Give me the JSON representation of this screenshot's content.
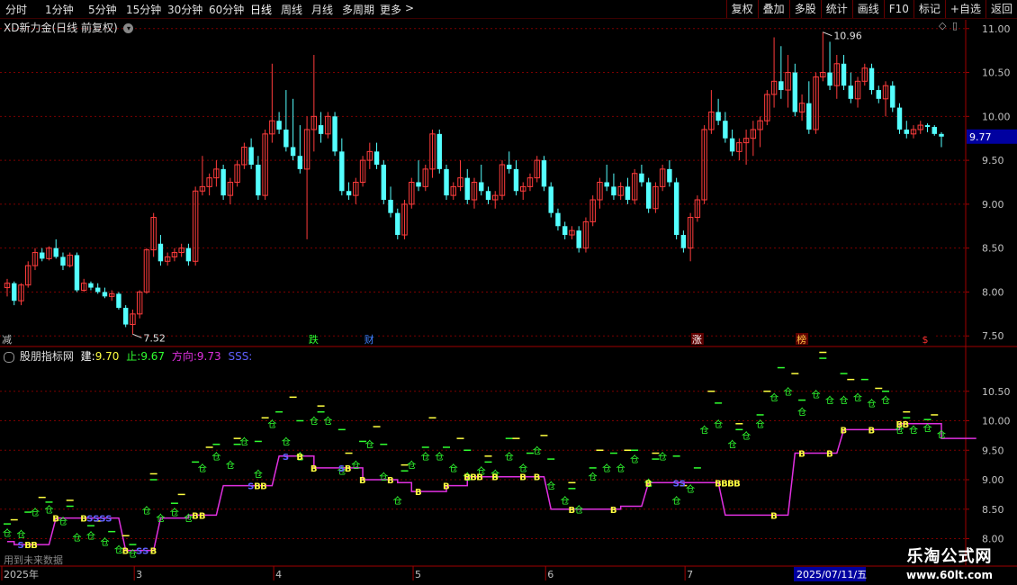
{
  "toolbar": {
    "periods": [
      "分时",
      "1分钟",
      "5分钟",
      "15分钟",
      "30分钟",
      "60分钟",
      "日线",
      "周线",
      "月线",
      "多周期",
      "更多"
    ],
    "active_period": "日线",
    "more_arrow": ">",
    "right_buttons": [
      "复权",
      "叠加",
      "多股",
      "统计",
      "画线",
      "F10",
      "标记",
      "+自选",
      "返回"
    ]
  },
  "main_panel": {
    "title": "XD新力金(日线 前复权)",
    "dropdown_icon": "circle-down-icon",
    "y_ticks": [
      "11.00",
      "10.50",
      "10.00",
      "9.50",
      "9.00",
      "8.50",
      "8.00",
      "7.50"
    ],
    "current_price": "9.77",
    "high_label": "10.96",
    "low_label": "7.52",
    "event_markers": [
      "减",
      "跌",
      "财",
      "涨",
      "榜",
      "$"
    ]
  },
  "indicator_panel": {
    "name": "股朋指标网",
    "jian_label": "建:",
    "jian_value": "9.70",
    "zhi_label": "止:",
    "zhi_value": "9.67",
    "fx_label": "方向:",
    "fx_value": "9.73",
    "sss": "SSS:",
    "y_ticks": [
      "10.50",
      "10.00",
      "9.50",
      "9.00",
      "8.50",
      "8.00"
    ],
    "future_note": "用到未来数据"
  },
  "xaxis": {
    "labels": [
      "2025年",
      "3",
      "4",
      "5",
      "6",
      "7"
    ],
    "date_box": "2025/07/11/五"
  },
  "watermark": {
    "title": "乐淘公式网",
    "url": "www.60lt.com"
  },
  "colors": {
    "up": "#ff3c3c",
    "down": "#54ffff",
    "grid": "#7a0000",
    "line": "#e030e0",
    "buy": "#ffff40",
    "sell": "#6060ff",
    "green": "#30ff30"
  },
  "chart_data": {
    "type": "candlestick",
    "ylim": [
      7.4,
      11.1
    ],
    "candles": [
      [
        8.05,
        8.15,
        7.95,
        8.1
      ],
      [
        8.1,
        8.12,
        7.85,
        7.9
      ],
      [
        7.9,
        8.1,
        7.85,
        8.08
      ],
      [
        8.08,
        8.35,
        8.05,
        8.3
      ],
      [
        8.3,
        8.5,
        8.25,
        8.45
      ],
      [
        8.45,
        8.5,
        8.35,
        8.38
      ],
      [
        8.38,
        8.52,
        8.36,
        8.5
      ],
      [
        8.5,
        8.6,
        8.38,
        8.4
      ],
      [
        8.4,
        8.45,
        8.25,
        8.3
      ],
      [
        8.3,
        8.45,
        8.28,
        8.42
      ],
      [
        8.42,
        8.45,
        8.0,
        8.02
      ],
      [
        8.02,
        8.15,
        8.0,
        8.1
      ],
      [
        8.1,
        8.12,
        8.02,
        8.05
      ],
      [
        8.05,
        8.1,
        7.98,
        8.0
      ],
      [
        8.0,
        8.05,
        7.93,
        7.95
      ],
      [
        7.95,
        8.02,
        7.9,
        7.98
      ],
      [
        7.98,
        8.0,
        7.8,
        7.82
      ],
      [
        7.82,
        7.85,
        7.6,
        7.63
      ],
      [
        7.63,
        7.8,
        7.52,
        7.75
      ],
      [
        7.75,
        8.02,
        7.7,
        8.0
      ],
      [
        8.0,
        8.5,
        7.98,
        8.48
      ],
      [
        8.48,
        8.9,
        8.4,
        8.85
      ],
      [
        8.55,
        8.65,
        8.3,
        8.35
      ],
      [
        8.35,
        8.45,
        8.3,
        8.4
      ],
      [
        8.4,
        8.5,
        8.35,
        8.45
      ],
      [
        8.45,
        8.55,
        8.4,
        8.5
      ],
      [
        8.5,
        8.55,
        8.3,
        8.35
      ],
      [
        8.35,
        9.2,
        8.3,
        9.15
      ],
      [
        9.15,
        9.55,
        9.1,
        9.2
      ],
      [
        9.2,
        9.35,
        9.1,
        9.3
      ],
      [
        9.3,
        9.5,
        9.2,
        9.4
      ],
      [
        9.4,
        9.45,
        9.05,
        9.1
      ],
      [
        9.1,
        9.3,
        9.0,
        9.25
      ],
      [
        9.25,
        9.5,
        9.2,
        9.45
      ],
      [
        9.45,
        9.7,
        9.4,
        9.65
      ],
      [
        9.65,
        9.75,
        9.4,
        9.45
      ],
      [
        9.45,
        9.55,
        9.05,
        9.1
      ],
      [
        9.1,
        9.85,
        9.05,
        9.8
      ],
      [
        9.8,
        10.6,
        9.7,
        9.95
      ],
      [
        9.95,
        10.05,
        9.8,
        9.85
      ],
      [
        9.85,
        10.3,
        9.6,
        9.65
      ],
      [
        9.65,
        10.2,
        9.5,
        9.55
      ],
      [
        9.55,
        9.9,
        9.35,
        9.4
      ],
      [
        9.4,
        10.0,
        8.6,
        9.85
      ],
      [
        9.85,
        10.7,
        9.6,
        10.0
      ],
      [
        9.9,
        10.05,
        9.7,
        9.8
      ],
      [
        9.8,
        10.05,
        9.75,
        10.0
      ],
      [
        10.0,
        10.05,
        9.55,
        9.6
      ],
      [
        9.6,
        9.75,
        9.1,
        9.15
      ],
      [
        9.15,
        9.25,
        9.05,
        9.1
      ],
      [
        9.1,
        9.3,
        9.0,
        9.25
      ],
      [
        9.25,
        9.55,
        9.2,
        9.5
      ],
      [
        9.5,
        9.7,
        9.4,
        9.6
      ],
      [
        9.6,
        9.7,
        9.4,
        9.45
      ],
      [
        9.45,
        9.5,
        9.0,
        9.05
      ],
      [
        9.05,
        9.2,
        8.85,
        8.9
      ],
      [
        8.9,
        8.95,
        8.6,
        8.65
      ],
      [
        8.65,
        9.05,
        8.6,
        9.0
      ],
      [
        9.0,
        9.3,
        8.95,
        9.25
      ],
      [
        9.25,
        9.5,
        9.15,
        9.2
      ],
      [
        9.2,
        9.45,
        9.15,
        9.4
      ],
      [
        9.4,
        9.85,
        9.3,
        9.8
      ],
      [
        9.8,
        9.85,
        9.35,
        9.4
      ],
      [
        9.4,
        9.45,
        9.05,
        9.1
      ],
      [
        9.1,
        9.25,
        9.05,
        9.2
      ],
      [
        9.2,
        9.5,
        9.15,
        9.3
      ],
      [
        9.3,
        9.4,
        9.0,
        9.05
      ],
      [
        9.05,
        9.3,
        8.95,
        9.25
      ],
      [
        9.25,
        9.45,
        9.1,
        9.15
      ],
      [
        9.15,
        9.2,
        9.0,
        9.05
      ],
      [
        9.05,
        9.15,
        8.95,
        9.1
      ],
      [
        9.1,
        9.5,
        9.05,
        9.45
      ],
      [
        9.45,
        9.6,
        9.35,
        9.4
      ],
      [
        9.4,
        9.5,
        9.1,
        9.15
      ],
      [
        9.15,
        9.25,
        9.05,
        9.2
      ],
      [
        9.2,
        9.35,
        9.15,
        9.3
      ],
      [
        9.3,
        9.55,
        9.25,
        9.5
      ],
      [
        9.5,
        9.55,
        9.15,
        9.2
      ],
      [
        9.2,
        9.25,
        8.85,
        8.9
      ],
      [
        8.9,
        8.95,
        8.7,
        8.75
      ],
      [
        8.75,
        8.8,
        8.6,
        8.65
      ],
      [
        8.65,
        8.75,
        8.6,
        8.7
      ],
      [
        8.7,
        8.75,
        8.45,
        8.5
      ],
      [
        8.5,
        8.85,
        8.45,
        8.8
      ],
      [
        8.8,
        9.1,
        8.75,
        9.05
      ],
      [
        9.05,
        9.3,
        8.95,
        9.25
      ],
      [
        9.25,
        9.45,
        9.15,
        9.2
      ],
      [
        9.2,
        9.35,
        9.05,
        9.1
      ],
      [
        9.1,
        9.25,
        9.05,
        9.2
      ],
      [
        9.2,
        9.3,
        9.0,
        9.05
      ],
      [
        9.05,
        9.4,
        9.0,
        9.35
      ],
      [
        9.35,
        9.45,
        9.2,
        9.25
      ],
      [
        9.25,
        9.3,
        8.9,
        8.95
      ],
      [
        8.95,
        9.25,
        8.9,
        9.2
      ],
      [
        9.2,
        9.45,
        9.15,
        9.4
      ],
      [
        9.4,
        9.5,
        9.2,
        9.25
      ],
      [
        9.25,
        9.3,
        8.6,
        8.65
      ],
      [
        8.65,
        8.7,
        8.45,
        8.5
      ],
      [
        8.5,
        8.9,
        8.35,
        8.85
      ],
      [
        8.85,
        9.1,
        8.8,
        9.05
      ],
      [
        9.05,
        9.9,
        9.0,
        9.85
      ],
      [
        9.85,
        10.3,
        9.8,
        10.05
      ],
      [
        10.05,
        10.2,
        9.9,
        9.95
      ],
      [
        9.95,
        10.05,
        9.7,
        9.75
      ],
      [
        9.75,
        9.85,
        9.55,
        9.6
      ],
      [
        9.6,
        9.75,
        9.5,
        9.7
      ],
      [
        9.7,
        9.85,
        9.45,
        9.75
      ],
      [
        9.75,
        9.95,
        9.55,
        9.85
      ],
      [
        9.85,
        10.0,
        9.65,
        9.95
      ],
      [
        9.95,
        10.3,
        9.9,
        10.25
      ],
      [
        10.25,
        10.9,
        10.1,
        10.4
      ],
      [
        10.4,
        10.8,
        10.2,
        10.3
      ],
      [
        10.3,
        10.7,
        10.1,
        10.5
      ],
      [
        10.5,
        10.6,
        10.0,
        10.05
      ],
      [
        10.05,
        10.25,
        9.95,
        10.15
      ],
      [
        10.15,
        10.4,
        9.8,
        9.85
      ],
      [
        9.85,
        10.5,
        9.8,
        10.45
      ],
      [
        10.45,
        10.96,
        10.4,
        10.5
      ],
      [
        10.5,
        10.85,
        10.3,
        10.35
      ],
      [
        10.35,
        10.7,
        10.2,
        10.6
      ],
      [
        10.6,
        10.7,
        10.3,
        10.35
      ],
      [
        10.35,
        10.5,
        10.15,
        10.2
      ],
      [
        10.2,
        10.45,
        10.1,
        10.4
      ],
      [
        10.4,
        10.6,
        10.35,
        10.55
      ],
      [
        10.55,
        10.6,
        10.25,
        10.3
      ],
      [
        10.3,
        10.35,
        10.15,
        10.2
      ],
      [
        10.2,
        10.4,
        10.0,
        10.35
      ],
      [
        10.35,
        10.4,
        10.05,
        10.1
      ],
      [
        10.1,
        10.15,
        9.8,
        9.85
      ],
      [
        9.85,
        9.95,
        9.75,
        9.8
      ],
      [
        9.8,
        9.9,
        9.75,
        9.85
      ],
      [
        9.85,
        9.95,
        9.8,
        9.9
      ],
      [
        9.9,
        9.92,
        9.82,
        9.88
      ],
      [
        9.88,
        9.9,
        9.78,
        9.8
      ],
      [
        9.8,
        9.82,
        9.65,
        9.77
      ]
    ],
    "indicator_line": [
      7.95,
      7.9,
      7.9,
      7.9,
      7.9,
      7.9,
      7.9,
      8.35,
      8.35,
      8.35,
      8.35,
      8.35,
      8.35,
      8.35,
      8.35,
      8.35,
      8.35,
      7.8,
      7.8,
      7.8,
      7.8,
      7.8,
      8.35,
      8.35,
      8.35,
      8.35,
      8.4,
      8.4,
      8.4,
      8.4,
      8.4,
      8.9,
      8.9,
      8.9,
      8.9,
      8.9,
      8.9,
      8.9,
      8.9,
      9.4,
      9.4,
      9.4,
      9.4,
      9.4,
      9.2,
      9.2,
      9.2,
      9.2,
      9.2,
      9.2,
      9.2,
      9.0,
      9.0,
      9.0,
      9.0,
      9.0,
      8.95,
      8.95,
      8.8,
      8.8,
      8.8,
      8.8,
      8.8,
      8.9,
      8.9,
      8.9,
      9.05,
      9.05,
      9.05,
      9.05,
      9.05,
      9.05,
      9.05,
      9.05,
      9.05,
      9.05,
      9.05,
      9.05,
      8.5,
      8.5,
      8.5,
      8.5,
      8.5,
      8.5,
      8.5,
      8.5,
      8.5,
      8.5,
      8.55,
      8.55,
      8.55,
      8.55,
      8.95,
      8.95,
      8.95,
      8.95,
      8.95,
      8.95,
      8.95,
      8.95,
      8.95,
      8.95,
      8.95,
      8.4,
      8.4,
      8.4,
      8.4,
      8.4,
      8.4,
      8.4,
      8.4,
      8.4,
      8.4,
      9.45,
      9.45,
      9.45,
      9.45,
      9.45,
      9.45,
      9.45,
      9.85,
      9.85,
      9.85,
      9.85,
      9.85,
      9.85,
      9.85,
      9.85,
      9.95,
      9.95,
      9.95,
      9.95,
      9.95,
      9.95,
      9.7,
      9.7,
      9.7,
      9.7,
      9.7,
      9.7
    ],
    "signals": [
      [
        2,
        "S",
        "sell"
      ],
      [
        3,
        "BB",
        "buy"
      ],
      [
        7,
        "B",
        "buy"
      ],
      [
        11,
        "BSSSS",
        "sell"
      ],
      [
        17,
        "B",
        "buy"
      ],
      [
        19,
        "SS",
        "sell"
      ],
      [
        21,
        "B",
        "buy"
      ],
      [
        27,
        "B",
        "buy"
      ],
      [
        28,
        "B",
        "buy"
      ],
      [
        35,
        "SBB",
        "buy"
      ],
      [
        40,
        "S",
        "sell"
      ],
      [
        42,
        "B",
        "buy"
      ],
      [
        44,
        "B",
        "buy"
      ],
      [
        48,
        "SB",
        "sell"
      ],
      [
        51,
        "B",
        "buy"
      ],
      [
        55,
        "B",
        "buy"
      ],
      [
        59,
        "B",
        "buy"
      ],
      [
        63,
        "B",
        "buy"
      ],
      [
        66,
        "BBB",
        "buy"
      ],
      [
        70,
        "B",
        "buy"
      ],
      [
        74,
        "B",
        "buy"
      ],
      [
        76,
        "B",
        "buy"
      ],
      [
        81,
        "B",
        "buy"
      ],
      [
        87,
        "B",
        "buy"
      ],
      [
        92,
        "B",
        "buy"
      ],
      [
        96,
        "SS",
        "sell"
      ],
      [
        102,
        "BBBB",
        "buy"
      ],
      [
        110,
        "B",
        "buy"
      ],
      [
        114,
        "B",
        "buy"
      ],
      [
        118,
        "B",
        "buy"
      ],
      [
        120,
        "B",
        "buy"
      ],
      [
        124,
        "B",
        "buy"
      ],
      [
        128,
        "BB",
        "buy"
      ]
    ]
  }
}
